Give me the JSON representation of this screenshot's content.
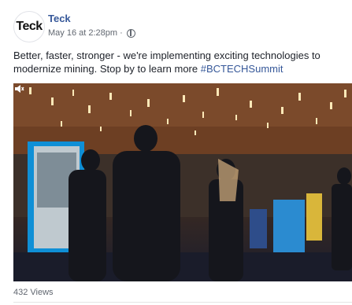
{
  "post": {
    "author": "Teck",
    "avatar_text": "Teck",
    "timestamp": "May 16 at 2:28pm",
    "separator": "·",
    "privacy_icon": "globe-icon",
    "text": "Better, faster, stronger - we're implementing exciting technologies to modernize mining. Stop by to learn more",
    "hashtag": "#BCTECHSummit",
    "video_icon": "volume-icon",
    "views": "432 Views"
  },
  "colors": {
    "link": "#365899",
    "meta": "#616770"
  }
}
